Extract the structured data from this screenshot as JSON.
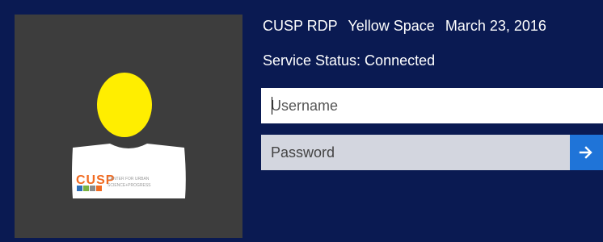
{
  "header": {
    "org": "CUSP RDP",
    "space": "Yellow Space",
    "date": "March 23, 2016",
    "status": "Service Status: Connected"
  },
  "login": {
    "username_placeholder": "Username",
    "username_value": "",
    "password_placeholder": "Password",
    "password_value": "",
    "submit_icon": "arrow-right-icon"
  },
  "avatar": {
    "head_color": "#ffee00",
    "logo_text": "CUSP",
    "logo_subtitle_1": "CENTER FOR URBAN",
    "logo_subtitle_2": "SCIENCE+PROGRESS"
  },
  "colors": {
    "background": "#0a1a52",
    "tile": "#3d3d3d",
    "accent": "#1f74d8"
  }
}
